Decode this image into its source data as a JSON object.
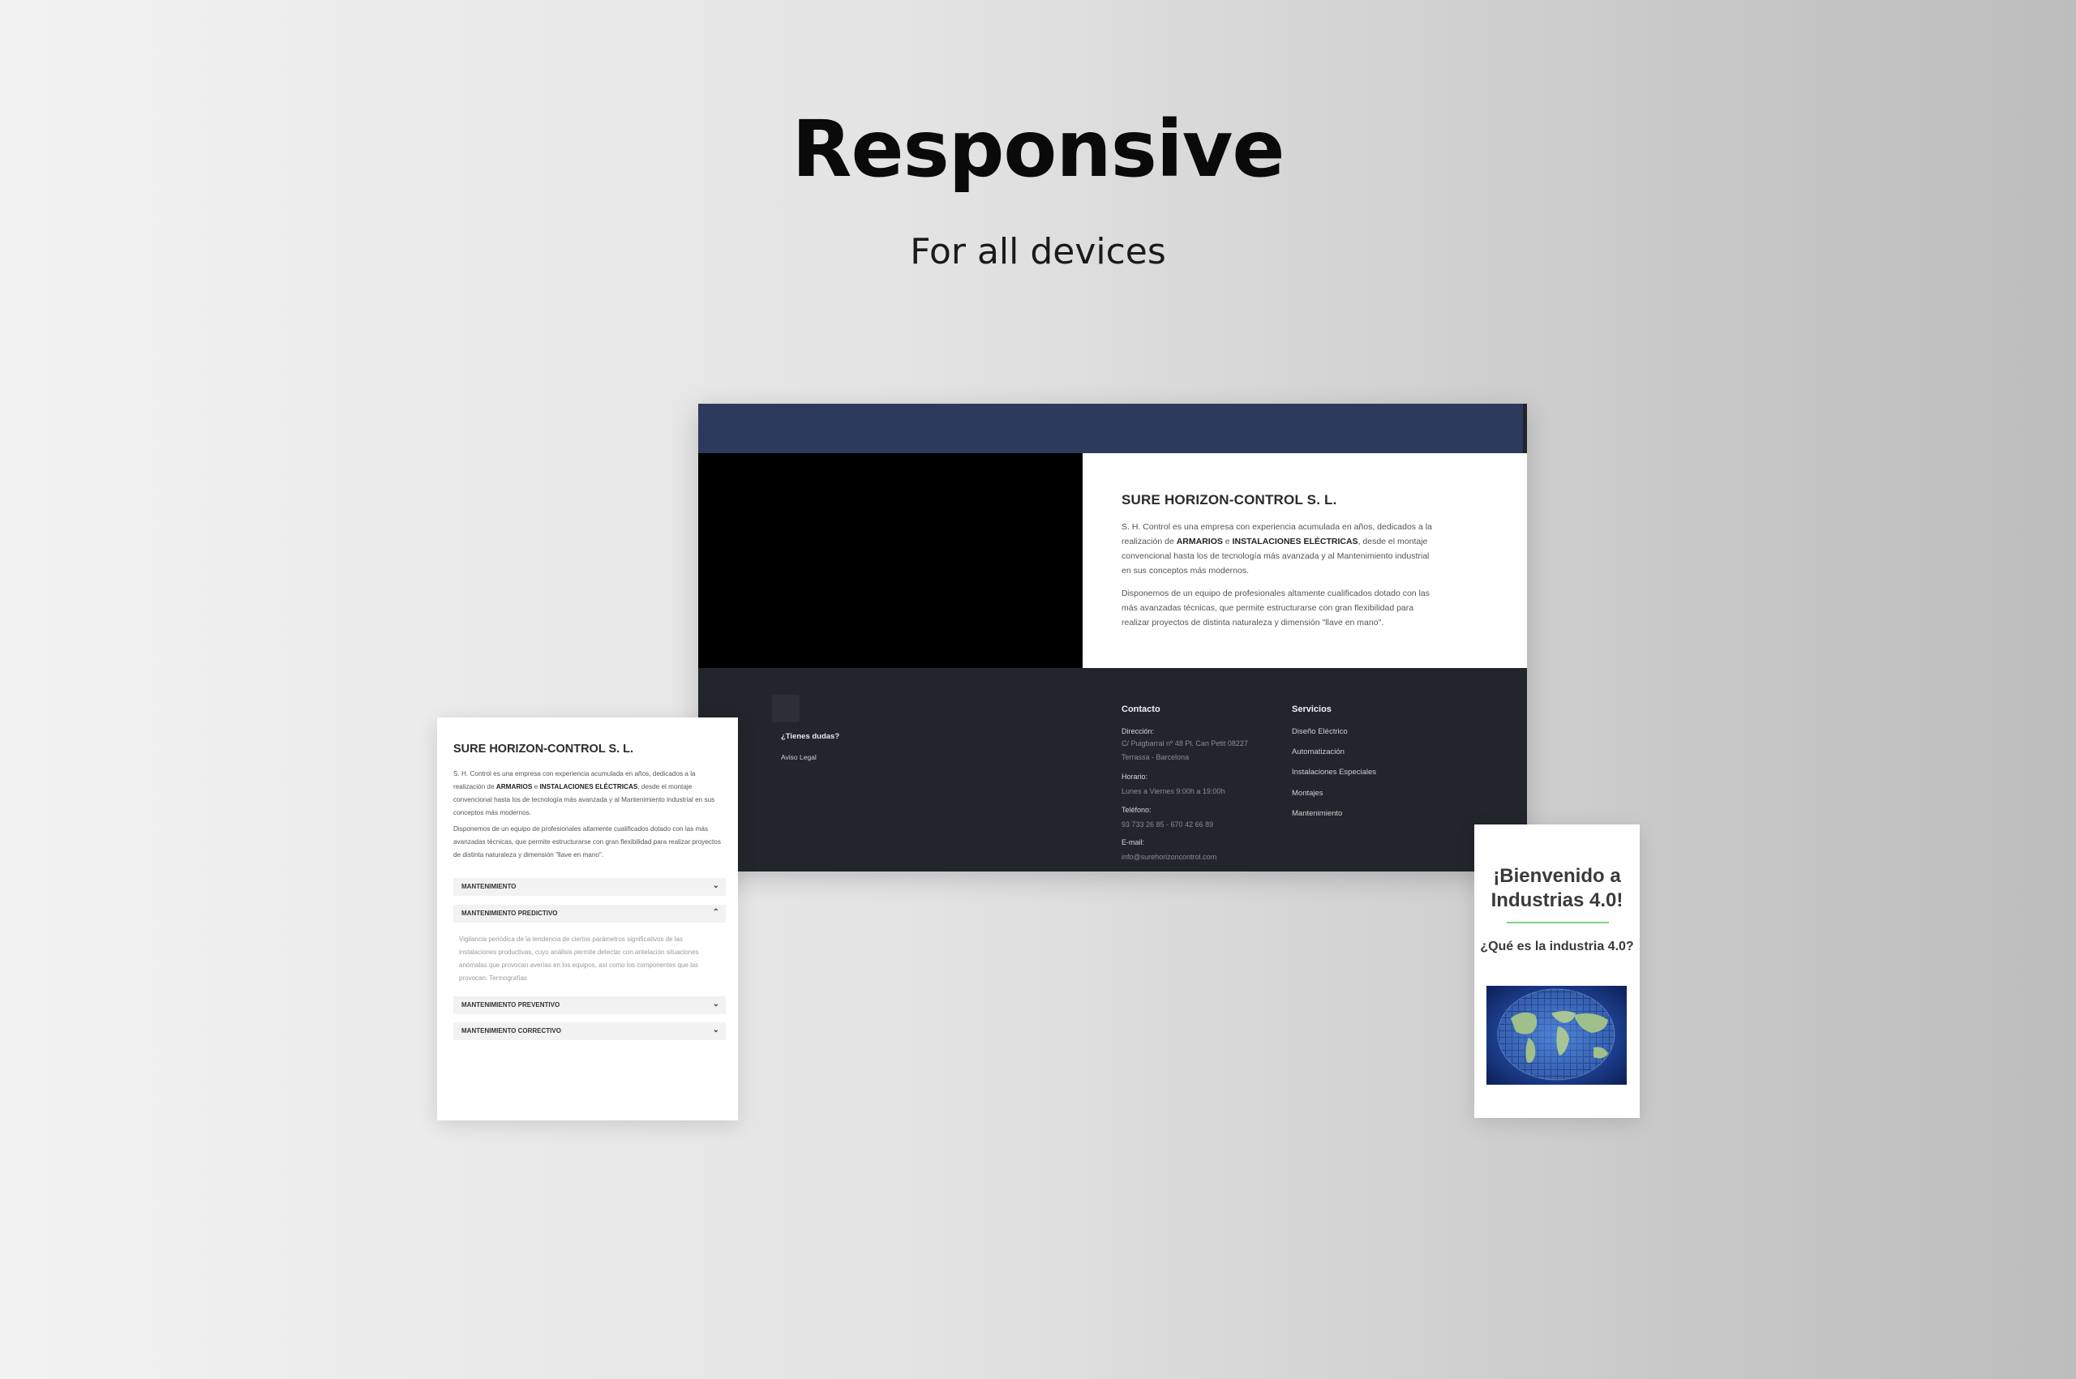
{
  "hero": {
    "title": "Responsive",
    "subtitle": "For all devices"
  },
  "desktop": {
    "nav_items": [
      "",
      "",
      "",
      ""
    ],
    "about_title": "SURE HORIZON-CONTROL S. L.",
    "about_p1_a": "S. H. Control es una empresa con experiencia acumulada en años, dedicados a la realización de ",
    "about_p1_b1": "ARMARIOS",
    "about_p1_c": " e ",
    "about_p1_b2": "INSTALACIONES ELÉCTRICAS",
    "about_p1_d": ", desde el montaje convencional hasta los de tecnología más avanzada y al Mantenimiento industrial en sus conceptos más modernos.",
    "about_p2": "Disponemos de un equipo de profesionales altamente cualificados dotado con las más avanzadas técnicas, que permite estructurarse con gran flexibilidad para realizar proyectos de distinta naturaleza y dimensión \"llave en mano\".",
    "footer": {
      "faq": "¿Tienes dudas?",
      "legal": "Aviso Legal",
      "contact_heading": "Contacto",
      "address_label": "Dirección:",
      "address_value": "C/ Puigbarral nº 48 Pl. Can Petit 08227 Terrassa - Barcelona",
      "hours_label": "Horario:",
      "hours_value": "Lunes a Viernes 9:00h a 19:00h",
      "phone_label": "Teléfono:",
      "phone_value": "93 733 26 85 - 670 42 66 89",
      "email_label": "E-mail:",
      "email_value": "info@surehorizoncontrol.com",
      "services_heading": "Servicios",
      "services": [
        "Diseño Eléctrico",
        "Automatización",
        "Instalaciones Especiales",
        "Montajes",
        "Mantenimiento"
      ]
    }
  },
  "tablet": {
    "title": "SURE HORIZON-CONTROL S. L.",
    "p1_a": "S. H. Control es una empresa con experiencia acumulada en años, dedicados a la realización de ",
    "p1_b1": "ARMARIOS",
    "p1_c": " e ",
    "p1_b2": "INSTALACIONES ELÉCTRICAS",
    "p1_d": ", desde el montaje convencional hasta los de tecnología más avanzada y al Mantenimiento industrial en sus conceptos más modernos.",
    "p2": "Disponemos de un equipo de profesionales altamente cualificados dotado con las más avanzadas técnicas, que permite estructurarse con gran flexibilidad para realizar proyectos de distinta naturaleza y dimensión \"llave en mano\".",
    "accordion": [
      {
        "label": "MANTENIMIENTO",
        "chevron": "⌄"
      },
      {
        "label": "MANTENIMIENTO PREDICTIVO",
        "chevron": "⌃"
      },
      {
        "label": "MANTENIMIENTO PREVENTIVO",
        "chevron": "⌄"
      },
      {
        "label": "MANTENIMIENTO CORRECTIVO",
        "chevron": "⌄"
      }
    ],
    "predictive_body": "Vigilancia periódica de la tendencia de ciertos parámetros significativos de las instalaciones productivas, cuyo análisis permite detectar con antelación situaciones anómalas que provocan averías en los equipos, así como los componentes que las provocan. Termografías"
  },
  "phone": {
    "welcome": "¡Bienvenido a Industrias 4.0!",
    "question": "¿Qué es la industria 4.0?"
  },
  "colors": {
    "nav": "#2c3a5e",
    "footer": "#22252b",
    "accent_line": "#7dd67d"
  }
}
